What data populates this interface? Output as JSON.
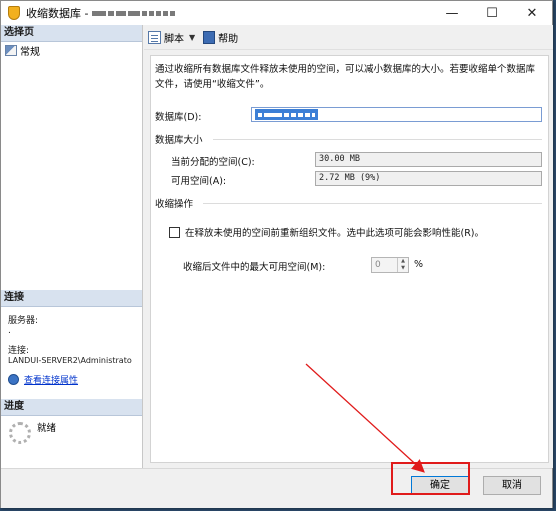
{
  "window": {
    "title": "收缩数据库 -"
  },
  "sidebar": {
    "select_page_header": "选择页",
    "items": [
      {
        "label": "常规",
        "icon": "general-page-icon"
      }
    ],
    "connection": {
      "header": "连接",
      "server_label": "服务器:",
      "server_value": ".",
      "connection_label": "连接:",
      "connection_value": "LANDUI-SERVER2\\Administrato",
      "view_properties_link": "查看连接属性"
    },
    "progress": {
      "header": "进度",
      "status": "就绪"
    }
  },
  "toolbar": {
    "script_label": "脚本",
    "help_label": "帮助"
  },
  "main": {
    "description": "通过收缩所有数据库文件释放未使用的空间，可以减小数据库的大小。若要收缩单个数据库文件，请使用“收缩文件”。",
    "database_label": "数据库(D):",
    "database_size_header": "数据库大小",
    "allocated_label": "当前分配的空间(C):",
    "allocated_value": "30.00 MB",
    "available_label": "可用空间(A):",
    "available_value": "2.72 MB (9%)",
    "shrink_action_header": "收缩操作",
    "reorganize_checkbox_label": "在释放未使用的空间前重新组织文件。选中此选项可能会影响性能(R)。",
    "reorganize_checked": false,
    "max_free_label": "收缩后文件中的最大可用空间(M):",
    "max_free_value": "0",
    "max_free_unit": "%"
  },
  "buttons": {
    "ok": "确定",
    "cancel": "取消"
  },
  "colors": {
    "annotation": "#e01b1b",
    "sidebar_header": "#d8e2ef",
    "link": "#0033cc"
  }
}
